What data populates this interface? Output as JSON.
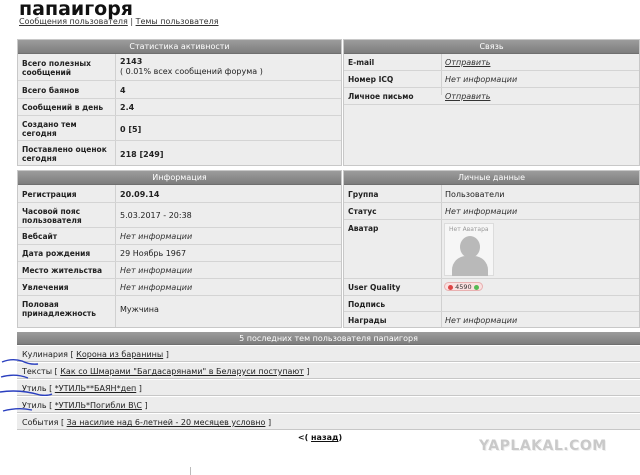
{
  "page": {
    "title": "папаигоря",
    "link_messages": "Сообщения пользователя",
    "separator": "|",
    "link_topics": "Темы пользователя"
  },
  "activity": {
    "header": "Статистика активности",
    "rows": [
      {
        "label": "Всего полезных сообщений",
        "value": "2143",
        "note": "( 0.01% всех сообщений форума )"
      },
      {
        "label": "Всего баянов",
        "value": "4"
      },
      {
        "label": "Сообщений в день",
        "value": "2.4"
      },
      {
        "label": "Создано тем сегодня",
        "value": "0 [5]"
      },
      {
        "label": "Поставлено оценок сегодня",
        "value": "218 [249]"
      }
    ]
  },
  "contact": {
    "header": "Связь",
    "rows": [
      {
        "label": "E-mail",
        "value": "Отправить"
      },
      {
        "label": "Номер ICQ",
        "value": "Нет информации"
      },
      {
        "label": "Личное письмо",
        "value": "Отправить"
      }
    ]
  },
  "info": {
    "header": "Информация",
    "rows": [
      {
        "label": "Регистрация",
        "value": "20.09.14"
      },
      {
        "label": "Часовой пояс пользователя",
        "value": "5.03.2017 - 20:38"
      },
      {
        "label": "Вебсайт",
        "value": "Нет информации"
      },
      {
        "label": "Дата рождения",
        "value": "29 Ноябрь 1967"
      },
      {
        "label": "Место жительства",
        "value": "Нет информации"
      },
      {
        "label": "Увлечения",
        "value": "Нет информации"
      },
      {
        "label": "Половая принадлежность",
        "value": "Мужчина"
      }
    ]
  },
  "personal": {
    "header": "Личные данные",
    "rows": [
      {
        "label": "Группа",
        "value": "Пользователи"
      },
      {
        "label": "Статус",
        "value": "Нет информации"
      },
      {
        "label": "Аватар",
        "value": ""
      },
      {
        "label": "User Quality",
        "value": "4590"
      },
      {
        "label": "Подпись",
        "value": ""
      },
      {
        "label": "Награды",
        "value": "Нет информации"
      }
    ],
    "avatar_text": "Нет Аватара"
  },
  "topics": {
    "header": "5 последних тем пользователя папаигоря",
    "items": [
      {
        "section": "Кулинария",
        "title": "Корона из баранины"
      },
      {
        "section": "Тексты",
        "title": "Как со Шмарами \"Багдасарянами\" в Беларуси поступают"
      },
      {
        "section": "Утиль",
        "title": "*УТИЛЬ**БАЯН*деп"
      },
      {
        "section": "Утиль",
        "title": "*УТИЛЬ*Погибли В\\С"
      },
      {
        "section": "События",
        "title": "За насилие над 6-летней - 20 месяцев условно"
      }
    ],
    "pager_prefix": "<(",
    "pager_link": "назад",
    "pager_suffix": ")"
  },
  "watermark": "YAPLAKAL.COM",
  "colors": {
    "header_bg": "#8a8a8a",
    "panel_bg": "#ededed",
    "scribble": "#2a3fbf"
  }
}
